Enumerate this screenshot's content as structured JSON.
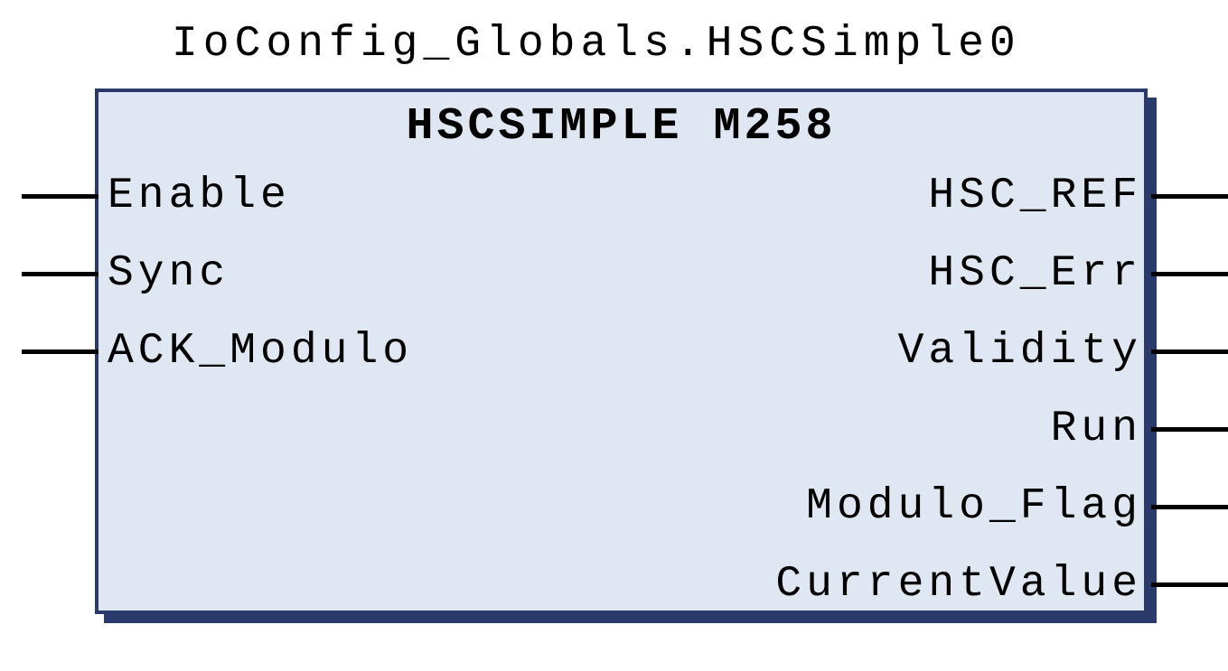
{
  "block": {
    "instance_name": "IoConfig_Globals.HSCSimple0",
    "title": "HSCSIMPLE M258",
    "inputs": [
      {
        "label": "Enable"
      },
      {
        "label": "Sync"
      },
      {
        "label": "ACK_Modulo"
      }
    ],
    "outputs": [
      {
        "label": "HSC_REF"
      },
      {
        "label": "HSC_Err"
      },
      {
        "label": "Validity"
      },
      {
        "label": "Run"
      },
      {
        "label": "Modulo_Flag"
      },
      {
        "label": "CurrentValue"
      }
    ]
  }
}
